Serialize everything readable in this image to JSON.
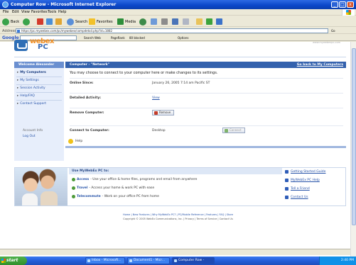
{
  "window": {
    "title": "Computer Row - Microsoft Internet Explorer",
    "controls": [
      "_",
      "□",
      "x"
    ]
  },
  "menubar": [
    "File",
    "Edit",
    "View",
    "Favorites",
    "Tools",
    "Help"
  ],
  "toolbar": {
    "back": "Back",
    "search": "Search",
    "favorites": "Favorites",
    "media": "Media"
  },
  "address": {
    "label": "Address",
    "url": "https://pc.mywebex.com/pc/mywebex/compdetail.php?id=1882",
    "go": "Go"
  },
  "gbar": {
    "logo": "Google",
    "search_web": "Search Web",
    "pagerank": "PageRank",
    "blocked": "80 blocked",
    "options": "Options"
  },
  "header": {
    "logo_my": "my",
    "logo_webex": "webex",
    "logo_pc": "PC",
    "right_text": "www.mywebexpc.com"
  },
  "leftnav": {
    "heading": "Welcome Alexander",
    "items": [
      "My Computers",
      "My Settings",
      "Session Activity",
      "Help/FAQ",
      "Contact Support"
    ],
    "account": "Account Info",
    "logout": "Log Out"
  },
  "main": {
    "heading": "Computer - \"Network\"",
    "back_link": "Go back to My Computers",
    "description": "You may choose to connect to your computer here or make changes to its settings.",
    "rows": [
      {
        "key": "Online Since:",
        "value": "January 26, 2005 7:14 am Pacific ST"
      },
      {
        "key": "Detailed Activity:",
        "value": "View"
      },
      {
        "key": "Remove Computer:",
        "value": "Remove"
      },
      {
        "key": "Connect to Computer:",
        "value": "Desktop",
        "button": "Connect"
      }
    ],
    "help": "Help"
  },
  "promo": {
    "title": "Use MyWebEx PC to:",
    "lines": [
      {
        "link": "Access",
        "text": "- Use your office & home files, programs and email from anywhere"
      },
      {
        "link": "Travel",
        "text": "- Access your home & work PC with ease"
      },
      {
        "link": "Telecommute",
        "text": "- Work on your office PC from home"
      }
    ],
    "links": [
      "Getting Started Guide",
      "MyWebEx PC Help",
      "Tell a Friend",
      "Contact Us"
    ]
  },
  "footer": {
    "links": "Home | New Features | Why MyWebEx PC? | PC/Mobile Reference | Features | FAQ | Store",
    "copyright": "Copyright © 2005 WebEx Communications, Inc. | Privacy | Terms of Service | Contact Us"
  },
  "taskbar": {
    "start": "start",
    "tasks": [
      "Inbox - Microsoft...",
      "Document1 - Micr...",
      "Computer Row -"
    ],
    "clock": "2:40 PM"
  },
  "colors": {
    "accent": "#3361ad",
    "nav_bg": "#e7eefb",
    "title_blue": "#0a46c8",
    "logo_orange": "#f28c1d"
  }
}
